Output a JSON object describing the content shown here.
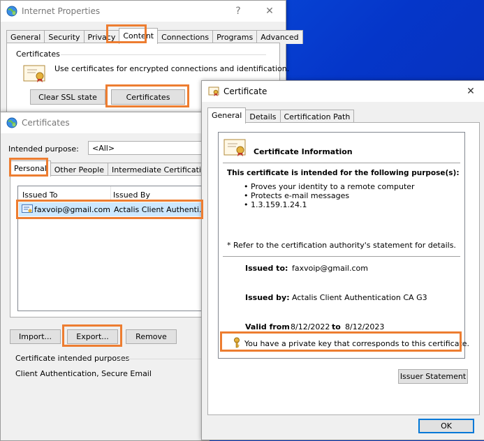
{
  "internet_properties": {
    "title": "Internet Properties",
    "help": "?",
    "close": "✕",
    "tabs": [
      "General",
      "Security",
      "Privacy",
      "Content",
      "Connections",
      "Programs",
      "Advanced"
    ],
    "group_title": "Certificates",
    "description": "Use certificates for encrypted connections and identification.",
    "clear_ssl_label": "Clear SSL state",
    "certificates_label": "Certificates"
  },
  "certificates_dialog": {
    "title": "Certificates",
    "intended_purpose_label": "Intended purpose:",
    "intended_purpose_value": "<All>",
    "tabs": [
      "Personal",
      "Other People",
      "Intermediate Certification Au"
    ],
    "columns": [
      "Issued To",
      "Issued By"
    ],
    "rows": [
      {
        "issued_to": "faxvoip@gmail.com",
        "issued_by": "Actalis Client Authenti..."
      }
    ],
    "import_label": "Import...",
    "export_label": "Export...",
    "remove_label": "Remove",
    "purposes_title": "Certificate intended purposes",
    "purposes_value": "Client Authentication, Secure Email"
  },
  "certificate_window": {
    "title": "Certificate",
    "close": "✕",
    "tabs": [
      "General",
      "Details",
      "Certification Path"
    ],
    "info_title": "Certificate Information",
    "intended_heading": "This certificate is intended for the following purpose(s):",
    "purposes": [
      "Proves your identity to a remote computer",
      "Protects e-mail messages",
      "1.3.159.1.24.1"
    ],
    "refer_note": "* Refer to the certification authority's statement for details.",
    "issued_to_label": "Issued to:",
    "issued_to_value": "faxvoip@gmail.com",
    "issued_by_label": "Issued by:",
    "issued_by_value": "Actalis Client Authentication CA G3",
    "valid_from_label": "Valid from",
    "valid_from_value": "8/12/2022",
    "valid_to_label": "to",
    "valid_to_value": "8/12/2023",
    "private_key_note": "You have a private key that corresponds to this certificate.",
    "issuer_statement_label": "Issuer Statement",
    "ok_label": "OK"
  },
  "accent_color": "#ed7d31"
}
